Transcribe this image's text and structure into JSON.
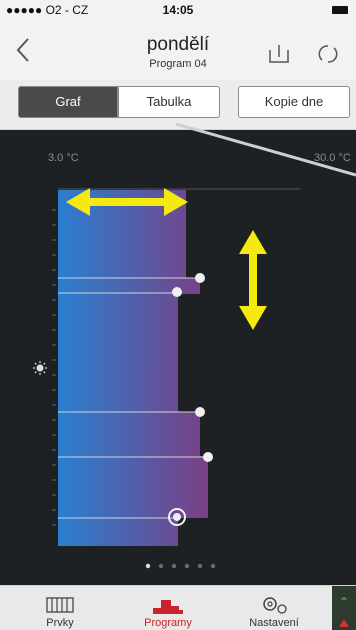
{
  "status_bar": {
    "carrier": "●●●●● O2 - CZ",
    "time": "14:05"
  },
  "nav": {
    "title": "pondělí",
    "subtitle": "Program 04"
  },
  "segments": {
    "graf": "Graf",
    "tabulka": "Tabulka",
    "kopie": "Kopie dne"
  },
  "chart": {
    "temp_min_label": "3.0 °C",
    "temp_max_label": "30.0 °C",
    "page_dots": 6,
    "active_page": 0,
    "colors": {
      "cold": "#2a7fd0",
      "warm": "#7a3f84",
      "arrow": "#f5ea0d"
    }
  },
  "tabs": {
    "prvky": "Prvky",
    "programy": "Programy",
    "nastaveni": "Nastavení"
  }
}
